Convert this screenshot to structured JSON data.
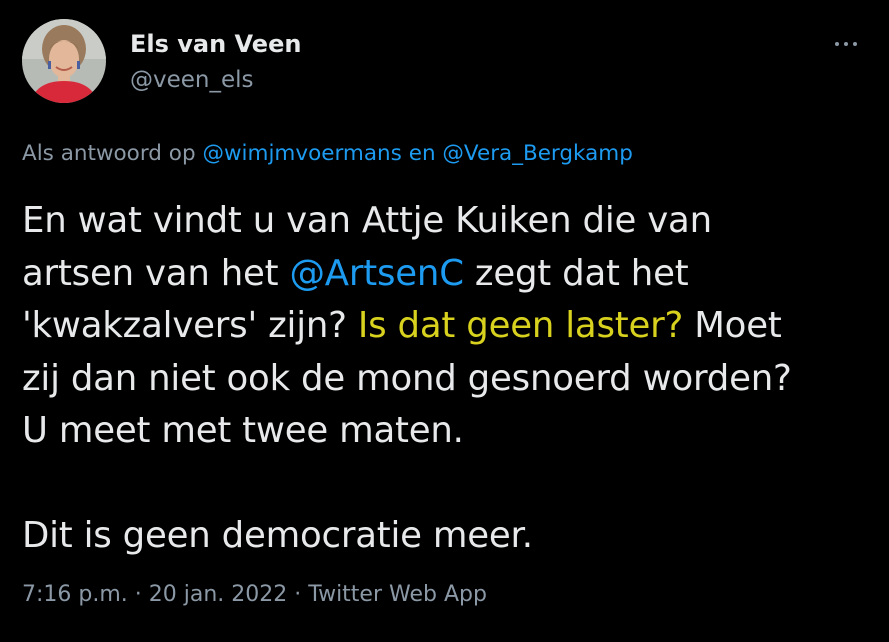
{
  "author": {
    "name": "Els van Veen",
    "handle": "@veen_els",
    "avatar": "profile-photo"
  },
  "reply_context": {
    "prefix": "Als antwoord op",
    "mention_1": "@wimjmvoermans",
    "conjunction": "en",
    "mention_2": "@Vera_Bergkamp"
  },
  "tweet": {
    "line1": "En wat vindt u van Attje Kuiken die van",
    "line2_pre": "artsen van het ",
    "line2_mention": "@ArtsenC",
    "line2_post": " zegt dat het",
    "line3_pre": "'kwakzalvers' zijn? ",
    "line3_highlight": "Is dat geen laster?",
    "line3_post": " Moet",
    "line4": "zij dan niet ook de mond gesnoerd worden?",
    "line5": "U meet met twee maten.",
    "line6": "Dit is geen democratie meer."
  },
  "meta": {
    "time": "7:16 p.m.",
    "separator": "·",
    "date": "20 jan. 2022",
    "source": "Twitter Web App"
  },
  "colors": {
    "background": "#000000",
    "text": "#e7e9ea",
    "secondary": "#8b98a5",
    "link": "#1d9bf0",
    "highlight": "#d8d21e"
  },
  "icons": {
    "more": "more-horizontal-icon"
  }
}
